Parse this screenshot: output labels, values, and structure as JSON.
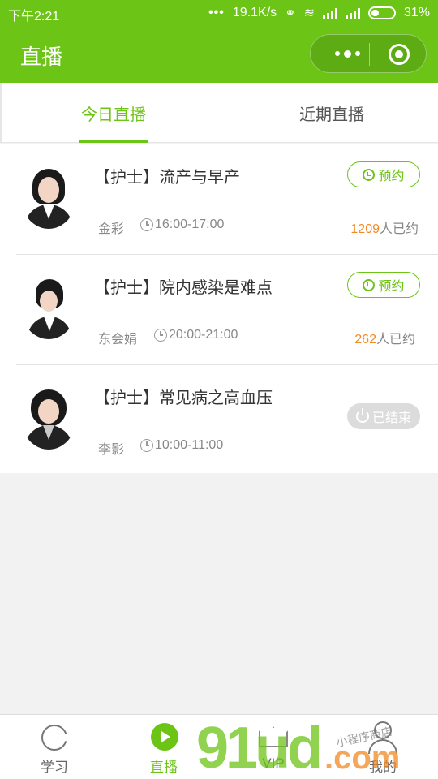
{
  "status_bar": {
    "time": "下午2:21",
    "dots": "•••",
    "speed": "19.1K/s",
    "battery": "31%"
  },
  "header": {
    "title": "直播"
  },
  "tabs": [
    {
      "label": "今日直播",
      "active": true
    },
    {
      "label": "近期直播",
      "active": false
    }
  ],
  "courses": [
    {
      "title": "【护士】流产与早产",
      "teacher": "金彩",
      "time": "16:00-17:00",
      "count": "1209",
      "count_suffix": "人已约",
      "button": "预约",
      "state": "reserve"
    },
    {
      "title": "【护士】院内感染是难点",
      "teacher": "东会娟",
      "time": "20:00-21:00",
      "count": "262",
      "count_suffix": "人已约",
      "button": "预约",
      "state": "reserve"
    },
    {
      "title": "【护士】常见病之高血压",
      "teacher": "李影",
      "time": "10:00-11:00",
      "button": "已结束",
      "state": "ended"
    }
  ],
  "tabbar": [
    {
      "label": "学习",
      "icon": "pacman-icon"
    },
    {
      "label": "直播",
      "icon": "play-icon",
      "active": true
    },
    {
      "label": "VIP",
      "icon": "crown-icon"
    },
    {
      "label": "我的",
      "icon": "person-icon"
    }
  ],
  "watermark": {
    "brand": "91ud",
    "tld": ".com",
    "tagline": "小程序商店"
  },
  "colors": {
    "accent": "#6cc417",
    "count": "#f08a24",
    "ended": "#dcdcdc"
  }
}
